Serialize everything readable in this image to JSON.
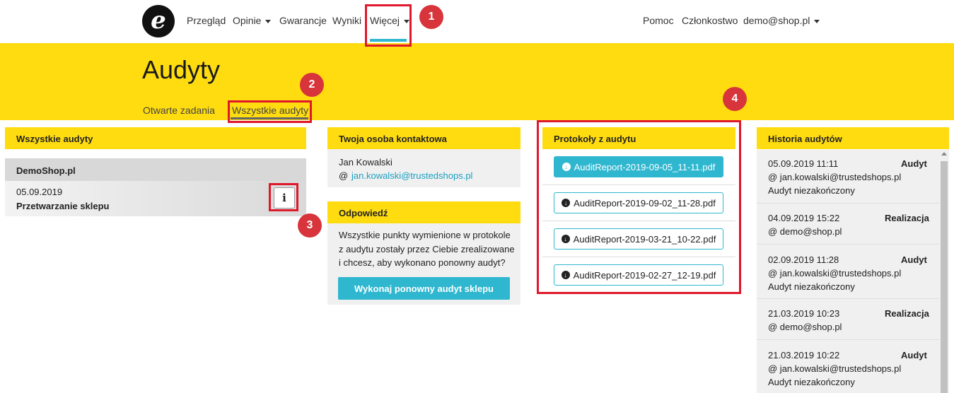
{
  "nav": {
    "logo": "e",
    "items": [
      "Przegląd",
      "Opinie",
      "Gwarancje",
      "Wyniki",
      "Więcej"
    ],
    "right": [
      "Pomoc",
      "Członkostwo",
      "demo@shop.pl"
    ]
  },
  "header": {
    "title": "Audyty",
    "tabs": [
      "Otwarte zadania",
      "Wszystkie audyty"
    ]
  },
  "badges": [
    "1",
    "2",
    "3",
    "4"
  ],
  "all_audits": {
    "title": "Wszystkie audyty",
    "shop": "DemoShop.pl",
    "date": "05.09.2019",
    "status": "Przetwarzanie sklepu",
    "info_label": "i"
  },
  "contact": {
    "title": "Twoja osoba kontaktowa",
    "name": "Jan Kowalski",
    "at": "@",
    "email": "jan.kowalski@trustedshops.pl"
  },
  "answer": {
    "title": "Odpowiedź",
    "lines": [
      "Wszystkie punkty wymienione w protokole",
      "z audytu zostały przez Ciebie zrealizowane",
      "i chcesz, aby wykonano ponowny audyt?"
    ],
    "button": "Wykonaj ponowny audyt sklepu"
  },
  "protocols": {
    "title": "Protokoły z audytu",
    "files": [
      "AuditReport-2019-09-05_11-11.pdf",
      "AuditReport-2019-09-02_11-28.pdf",
      "AuditReport-2019-03-21_10-22.pdf",
      "AuditReport-2019-02-27_12-19.pdf"
    ]
  },
  "history": {
    "title": "Historia audytów",
    "entries": [
      {
        "datetime": "05.09.2019 11:11",
        "type": "Audyt",
        "user": "@ jan.kowalski@trustedshops.pl",
        "note": "Audyt niezakończony"
      },
      {
        "datetime": "04.09.2019 15:22",
        "type": "Realizacja",
        "user": "@ demo@shop.pl",
        "note": ""
      },
      {
        "datetime": "02.09.2019 11:28",
        "type": "Audyt",
        "user": "@ jan.kowalski@trustedshops.pl",
        "note": "Audyt niezakończony"
      },
      {
        "datetime": "21.03.2019 10:23",
        "type": "Realizacja",
        "user": "@ demo@shop.pl",
        "note": ""
      },
      {
        "datetime": "21.03.2019 10:22",
        "type": "Audyt",
        "user": "@ jan.kowalski@trustedshops.pl",
        "note": "Audyt niezakończony"
      }
    ]
  },
  "colors": {
    "brand_yellow": "#ffdc0f",
    "accent": "#2fb7cf",
    "annotation_red": "#e0182c"
  }
}
